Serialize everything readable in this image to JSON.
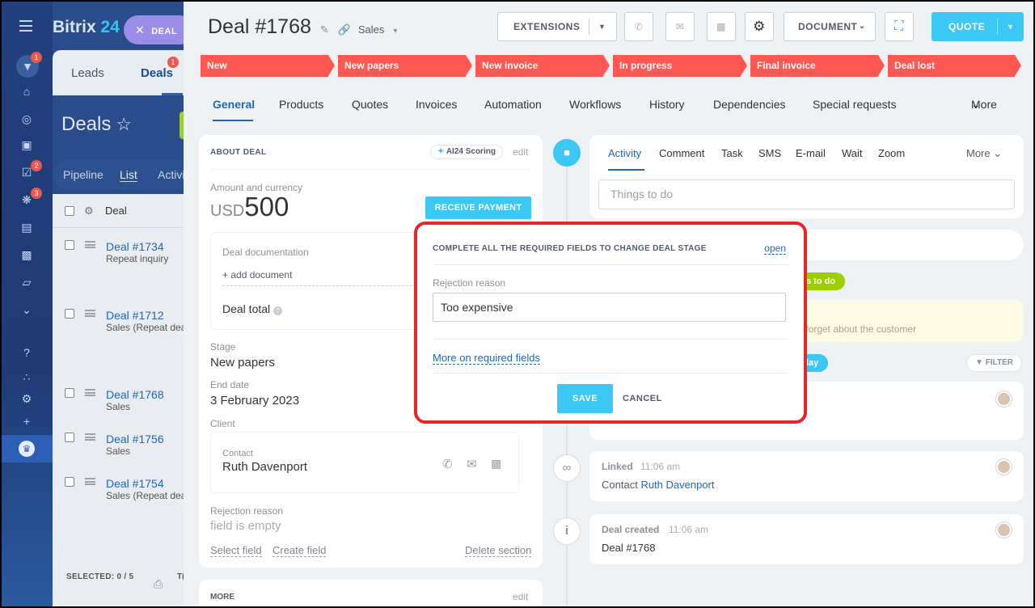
{
  "colors": {
    "accent": "#3bc8f5",
    "stage": "#ff5752",
    "link": "#2067b0",
    "highlight_border": "#ea2525"
  },
  "rail": {
    "badges": [
      "1",
      "2",
      "3"
    ],
    "icons": [
      "menu-icon",
      "funnel-icon",
      "bank-icon",
      "target-icon",
      "cart-icon",
      "tasks-icon",
      "apps-icon",
      "contact-card-icon",
      "robot-icon",
      "box-icon",
      "chevron-down-circle-icon",
      "help-icon",
      "sitemap-icon",
      "settings-icon",
      "plus-icon",
      "crown-icon"
    ]
  },
  "background": {
    "brand_main": "Bitrix",
    "brand_num": "24",
    "deal_pill": "DEAL",
    "tab_leads": "Leads",
    "tab_deals": "Deals",
    "tab_deals_badge": "1",
    "page_title": "Deals",
    "sub_pipeline": "Pipeline",
    "sub_list": "List",
    "sub_activities": "Activi",
    "col_deal": "Deal",
    "rows": [
      {
        "title": "Deal #1734",
        "sub": "Repeat inquiry"
      },
      {
        "title": "Deal #1712",
        "sub": "Sales (Repeat dea"
      },
      {
        "title": "Deal #1768",
        "sub": "Sales"
      },
      {
        "title": "Deal #1756",
        "sub": "Sales"
      },
      {
        "title": "Deal #1754",
        "sub": "Sales (Repeat dea"
      }
    ],
    "selected": "SELECTED: 0 / 5",
    "footer_partial": "T("
  },
  "header": {
    "title": "Deal #1768",
    "category": "Sales",
    "extensions": "EXTENSIONS",
    "document": "DOCUMENT",
    "quote": "QUOTE"
  },
  "stages": [
    "New",
    "New papers",
    "New invoice",
    "In progress",
    "Final invoice",
    "Deal lost"
  ],
  "tabs": [
    "General",
    "Products",
    "Quotes",
    "Invoices",
    "Automation",
    "Workflows",
    "History",
    "Dependencies",
    "Special requests"
  ],
  "tabs_more": "More",
  "about": {
    "heading": "ABOUT DEAL",
    "scoring": "AI24 Scoring",
    "edit": "edit",
    "amount_label": "Amount and currency",
    "currency": "USD",
    "amount": "500",
    "receive_payment": "RECEIVE PAYMENT",
    "doc_label": "Deal documentation",
    "add_doc": "+ add document",
    "deal_total": "Deal total",
    "stage_label": "Stage",
    "stage_value": "New papers",
    "end_label": "End date",
    "end_value": "3 February 2023",
    "client_label": "Client",
    "contact_label": "Contact",
    "contact_name": "Ruth Davenport",
    "rejection_label": "Rejection reason",
    "rejection_value": "field is empty",
    "select_field": "Select field",
    "create_field": "Create field",
    "delete_section": "Delete section",
    "more_heading": "MORE",
    "more_edit": "edit"
  },
  "activity": {
    "tabs": [
      "Activity",
      "Comment",
      "Task",
      "SMS",
      "E-mail",
      "Wait",
      "Zoom"
    ],
    "more": "More",
    "placeholder": "Things to do",
    "todo_tag": "s to do",
    "reminder": "r forget about the customer",
    "today_tag": "lay",
    "filter": "FILTER",
    "linked_title": "Linked",
    "linked_time": "11:06 am",
    "linked_text": "Contact",
    "linked_contact": "Ruth Davenport",
    "created_title": "Deal created",
    "created_time": "11:06 am",
    "created_text": "Deal #1768"
  },
  "modal": {
    "heading": "COMPLETE ALL THE REQUIRED FIELDS TO CHANGE DEAL STAGE",
    "open": "open",
    "field_label": "Rejection reason",
    "field_value": "Too expensive",
    "more_link": "More on required fields",
    "save": "SAVE",
    "cancel": "CANCEL"
  }
}
